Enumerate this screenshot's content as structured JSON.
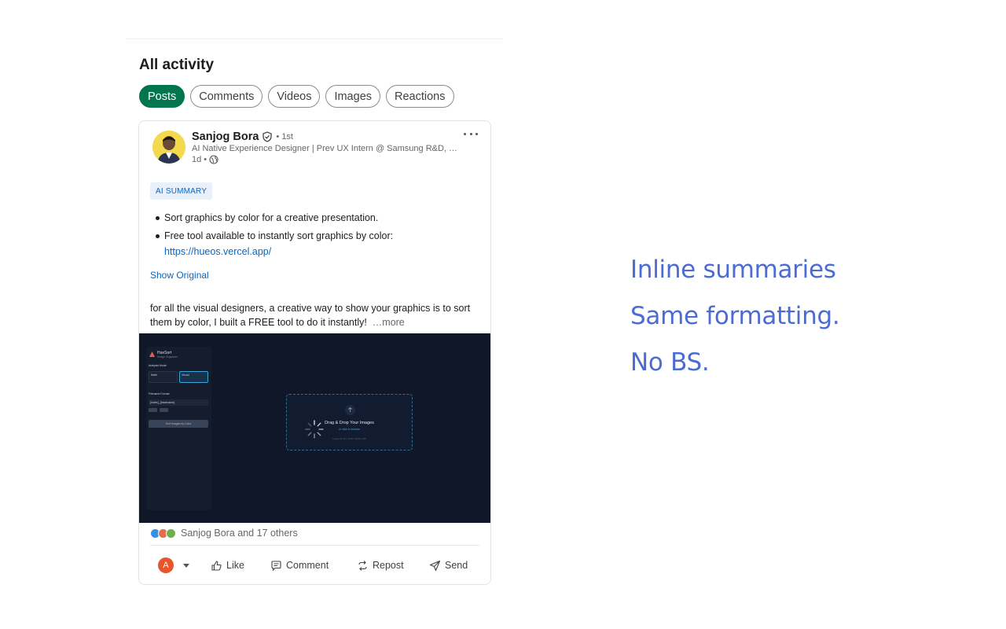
{
  "section_title": "All activity",
  "filters": [
    {
      "label": "Posts",
      "active": true
    },
    {
      "label": "Comments",
      "active": false
    },
    {
      "label": "Videos",
      "active": false
    },
    {
      "label": "Images",
      "active": false
    },
    {
      "label": "Reactions",
      "active": false
    }
  ],
  "post": {
    "author": {
      "name": "Sanjog Bora",
      "degree": "• 1st",
      "headline": "AI Native Experience Designer | Prev UX Intern @ Samsung R&D, Flyt...",
      "age": "1d •"
    },
    "ai_summary_badge": "AI SUMMARY",
    "summary_points": [
      "Sort graphics by color for a creative presentation.",
      "Free tool available to instantly sort graphics by color:"
    ],
    "summary_link": "https://hueos.vercel.app/",
    "show_original": "Show Original",
    "body_text": "for all the visual designers, a creative way to show your graphics is to sort them by color, I built a FREE tool to do it instantly!",
    "more_label": "…more",
    "media": {
      "app_name": "HueSort",
      "app_subtitle": "Image Organizer",
      "analysis_label": "Analysis Mode",
      "mode_math": "Math",
      "mode_visual": "Visual",
      "filename_label": "Filename Format",
      "filename_value": "{index}_{basename}",
      "sort_button": "Sort Images by Color",
      "drop_title": "Drag & Drop Your Images",
      "drop_subtitle": "or click to browse",
      "drop_hint": "Supports JPG, PNG, WebP, GIF"
    },
    "reactions_text": "Sanjog Bora and 17 others",
    "actions": {
      "actor_initial": "A",
      "like": "Like",
      "comment": "Comment",
      "repost": "Repost",
      "send": "Send"
    }
  },
  "taglines": [
    "Inline summaries",
    "Same formatting.",
    "No BS."
  ],
  "colors": {
    "accent_green": "#01754f",
    "link_blue": "#0a66c2",
    "tagline_blue": "#4a6cd4"
  }
}
